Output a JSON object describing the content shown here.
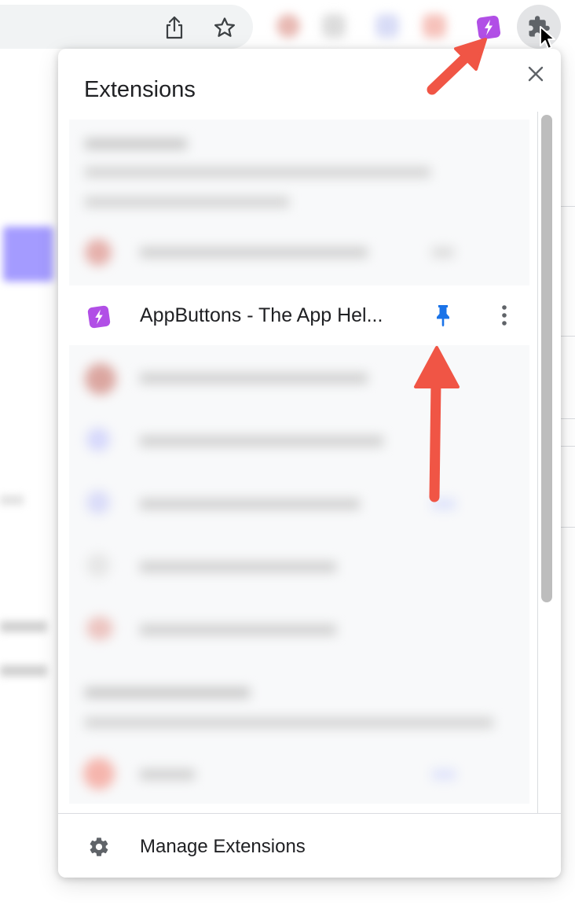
{
  "toolbar": {
    "share_icon": "share-icon",
    "bookmark_icon": "star-icon",
    "extensions_icon": "puzzle-icon",
    "pinned_app_icon": "appbuttons-icon"
  },
  "popup": {
    "title": "Extensions",
    "close_icon": "close-icon",
    "highlighted_extension": {
      "name": "AppButtons - The App Hel...",
      "pinned": true,
      "pin_color": "#1a73e8"
    },
    "footer": {
      "label": "Manage Extensions",
      "icon": "gear-icon"
    }
  },
  "colors": {
    "accent_purple": "#b14fe6",
    "annotation_arrow": "#f05545",
    "pin_blue": "#1a73e8"
  }
}
